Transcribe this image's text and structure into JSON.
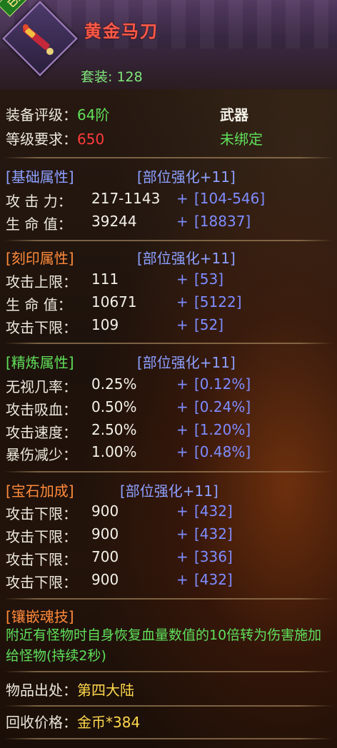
{
  "item": {
    "badge": "已鉴定",
    "name": "黄金马刀",
    "set_label": "套装",
    "set_value": "128"
  },
  "info": {
    "grade_label": "装备评级",
    "grade_value": "64阶",
    "type_value": "武器",
    "level_label": "等级要求",
    "level_value": "650",
    "bind_value": "未绑定"
  },
  "sections": {
    "base": {
      "title": "[基础属性]",
      "tag": "[部位强化+11]",
      "rows": [
        {
          "label": "攻 击 力：",
          "value": "217-1143",
          "bonus": "[104-546]"
        },
        {
          "label": "生 命 值：",
          "value": "39244",
          "bonus": "[18837]"
        }
      ]
    },
    "engrave": {
      "title": "[刻印属性]",
      "tag": "[部位强化+11]",
      "rows": [
        {
          "label": "攻击上限：",
          "value": "111",
          "bonus": "[53]"
        },
        {
          "label": "生 命 值：",
          "value": "10671",
          "bonus": "[5122]"
        },
        {
          "label": "攻击下限：",
          "value": "109",
          "bonus": "[52]"
        }
      ]
    },
    "refine": {
      "title": "[精炼属性]",
      "tag": "[部位强化+11]",
      "rows": [
        {
          "label": "无视几率：",
          "value": "0.25%",
          "bonus": "[0.12%]"
        },
        {
          "label": "攻击吸血：",
          "value": "0.50%",
          "bonus": "[0.24%]"
        },
        {
          "label": "攻击速度：",
          "value": "2.50%",
          "bonus": "[1.20%]"
        },
        {
          "label": "暴伤减少：",
          "value": "1.00%",
          "bonus": "[0.48%]"
        }
      ]
    },
    "gem": {
      "title": "[宝石加成]",
      "tag": "[部位强化+11]",
      "rows": [
        {
          "label": "攻击下限：",
          "value": "900",
          "bonus": "[432]"
        },
        {
          "label": "攻击下限：",
          "value": "900",
          "bonus": "[432]"
        },
        {
          "label": "攻击下限：",
          "value": "700",
          "bonus": "[336]"
        },
        {
          "label": "攻击下限：",
          "value": "900",
          "bonus": "[432]"
        }
      ]
    },
    "soul": {
      "title": "[镶嵌魂技]",
      "desc": "附近有怪物时自身恢复血量数值的10倍转为伤害施加给怪物(持续2秒)"
    }
  },
  "footer": {
    "origin_label": "物品出处：",
    "origin_value": "第四大陆",
    "price_label": "回收价格：",
    "price_value": "金币*384"
  },
  "plus_sign": "+",
  "colors": {
    "title": "#ff5a48",
    "green": "#5fe05a",
    "red": "#ff3b3b",
    "blue": "#8da0ff",
    "orange": "#ff8b3a"
  }
}
